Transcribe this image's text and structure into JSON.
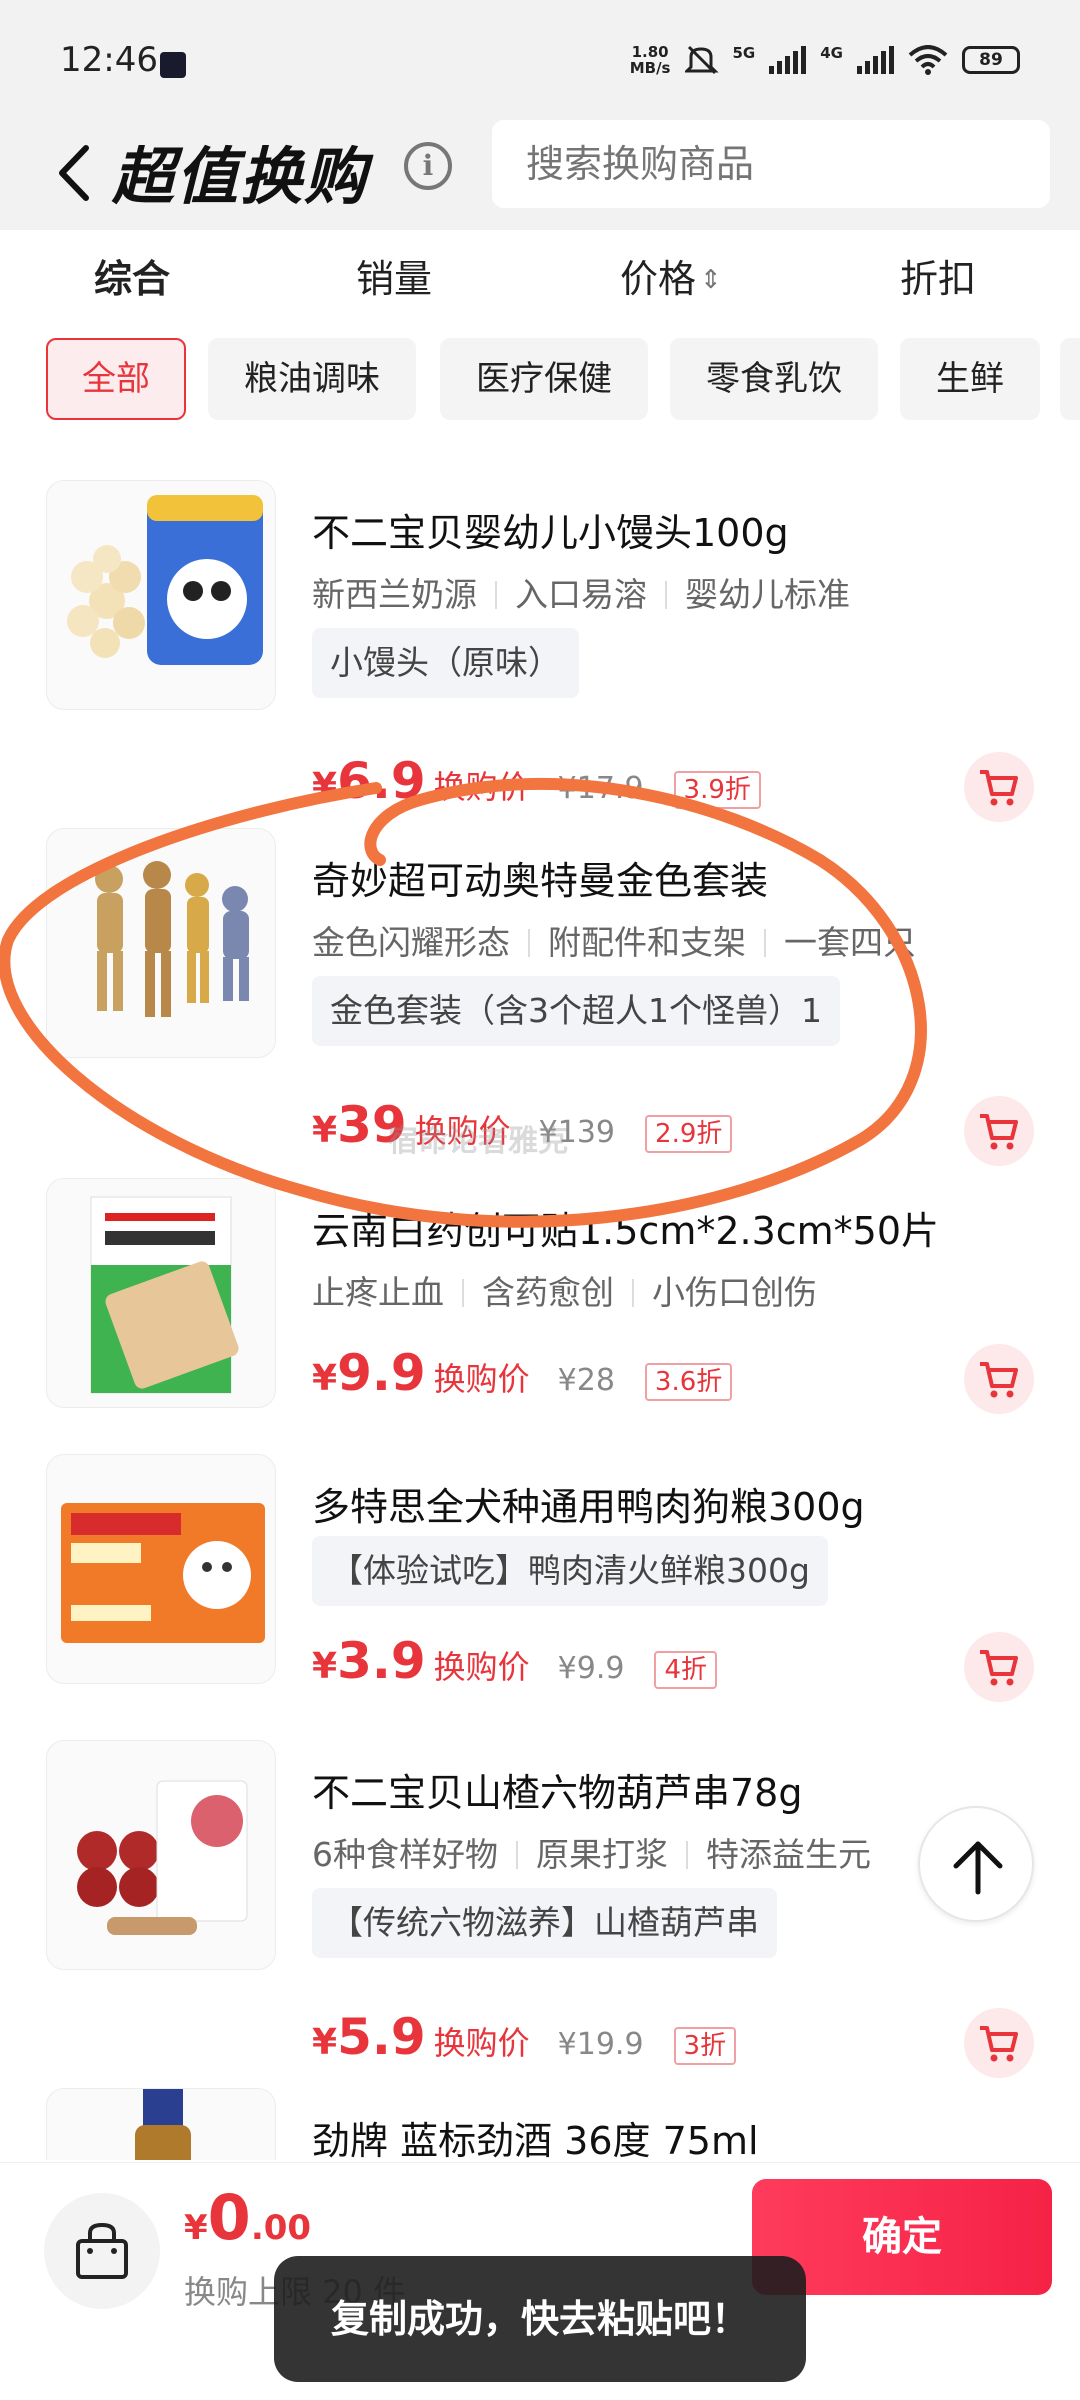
{
  "status_bar": {
    "time": "12:46",
    "net_speed_value": "1.80",
    "net_speed_unit": "MB/s",
    "sim1_label": "5G",
    "sim2_label": "4G",
    "battery": "89"
  },
  "header": {
    "title": "超值换购",
    "search_placeholder": "搜索换购商品"
  },
  "sort_tabs": [
    {
      "label": "综合",
      "active": true
    },
    {
      "label": "销量",
      "active": false
    },
    {
      "label": "价格",
      "active": false
    },
    {
      "label": "折扣",
      "active": false
    }
  ],
  "categories": [
    {
      "label": "全部",
      "active": true
    },
    {
      "label": "粮油调味",
      "active": false
    },
    {
      "label": "医疗保健",
      "active": false
    },
    {
      "label": "零食乳饮",
      "active": false
    },
    {
      "label": "生鲜",
      "active": false
    }
  ],
  "products": [
    {
      "name": "不二宝贝婴幼儿小馒头100g",
      "tags": [
        "新西兰奶源",
        "入口易溶",
        "婴幼儿标准"
      ],
      "spec": "小馒头（原味）",
      "currency": "¥",
      "price": "6.9",
      "price_label": "换购价",
      "original_price": "¥17.9",
      "discount": "3.9折"
    },
    {
      "name": "奇妙超可动奥特曼金色套装",
      "tags": [
        "金色闪耀形态",
        "附配件和支架",
        "一套四只"
      ],
      "spec": "金色套装（含3个超人1个怪兽）1",
      "currency": "¥",
      "price": "39",
      "price_label": "换购价",
      "original_price": "¥139",
      "discount": "2.9折"
    },
    {
      "name": "云南白药创可贴1.5cm*2.3cm*50片",
      "tags": [
        "止疼止血",
        "含药愈创",
        "小伤口创伤"
      ],
      "spec": "",
      "currency": "¥",
      "price": "9.9",
      "price_label": "换购价",
      "original_price": "¥28",
      "discount": "3.6折"
    },
    {
      "name": "多特思全犬种通用鸭肉狗粮300g",
      "tags": [],
      "spec": "【体验试吃】鸭肉清火鲜粮300g",
      "currency": "¥",
      "price": "3.9",
      "price_label": "换购价",
      "original_price": "¥9.9",
      "discount": "4折"
    },
    {
      "name": "不二宝贝山楂六物葫芦串78g",
      "tags": [
        "6种食样好物",
        "原果打浆",
        "特添益生元"
      ],
      "spec": "【传统六物滋养】山楂葫芦串",
      "currency": "¥",
      "price": "5.9",
      "price_label": "换购价",
      "original_price": "¥19.9",
      "discount": "3折"
    },
    {
      "name": "劲牌 蓝标劲酒 36度 75ml",
      "tags": [],
      "spec": "",
      "currency": "",
      "price": "",
      "price_label": "",
      "original_price": "",
      "discount": ""
    }
  ],
  "bottom_bar": {
    "currency": "¥",
    "total_int": "0",
    "total_dec": ".00",
    "limit_text": "换购上限 20 件",
    "confirm_label": "确定"
  },
  "toast": "复制成功，快去粘贴吧！",
  "watermark": "宿命论者雅克",
  "colors": {
    "accent": "#e8343b",
    "confirm": "#f52246",
    "scribble": "#f2743f"
  }
}
